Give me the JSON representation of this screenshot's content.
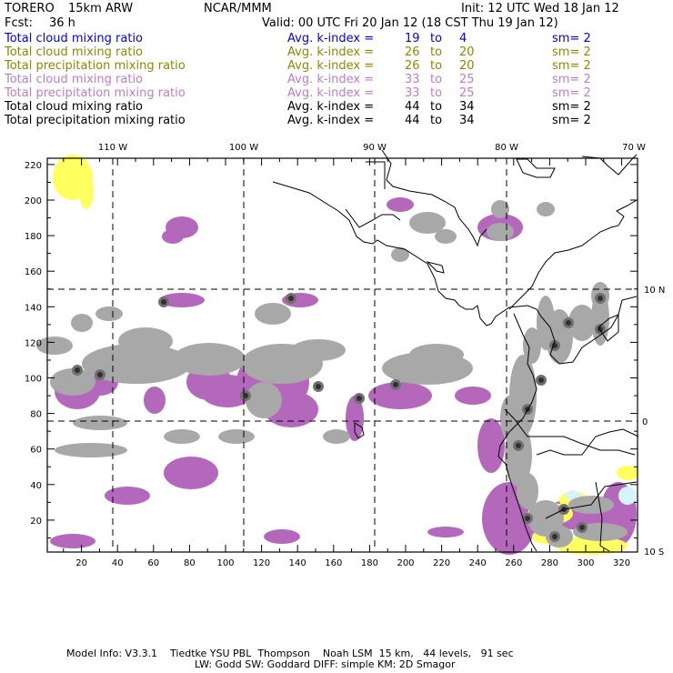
{
  "header": {
    "model": "TORERO",
    "resolution": "15km ARW",
    "org": "NCAR/MMM",
    "init": "Init: 12 UTC Wed 18 Jan 12",
    "fcst_label": "Fcst:",
    "fcst_value": "36 h",
    "valid": "Valid: 00 UTC Fri 20 Jan 12 (18 CST Thu 19 Jan 12)"
  },
  "legend": [
    {
      "field": "Total cloud mixing ratio",
      "avg": "Avg. k-index =",
      "from": "19",
      "to_word": "to",
      "to": "4",
      "sm": "sm= 2",
      "color": "#0000f0"
    },
    {
      "field": "Total cloud mixing ratio",
      "avg": "Avg. k-index =",
      "from": "26",
      "to_word": "to",
      "to": "20",
      "sm": "sm= 2",
      "color": "#8a8a00"
    },
    {
      "field": "Total precipitation mixing ratio",
      "avg": "Avg. k-index =",
      "from": "26",
      "to_word": "to",
      "to": "20",
      "sm": "sm= 2",
      "color": "#8a8a00"
    },
    {
      "field": "Total cloud mixing ratio",
      "avg": "Avg. k-index =",
      "from": "33",
      "to_word": "to",
      "to": "25",
      "sm": "sm= 2",
      "color": "#c07cc8"
    },
    {
      "field": "Total precipitation mixing ratio",
      "avg": "Avg. k-index =",
      "from": "33",
      "to_word": "to",
      "to": "25",
      "sm": "sm= 2",
      "color": "#c07cc8"
    },
    {
      "field": "Total cloud mixing ratio",
      "avg": "Avg. k-index =",
      "from": "44",
      "to_word": "to",
      "to": "34",
      "sm": "sm= 2",
      "color": "#000000"
    },
    {
      "field": "Total precipitation mixing ratio",
      "avg": "Avg. k-index =",
      "from": "44",
      "to_word": "to",
      "to": "34",
      "sm": "sm= 2",
      "color": "#000000"
    }
  ],
  "map": {
    "lon_labels": [
      "110 W",
      "100 W",
      "90 W",
      "80 W",
      "70 W"
    ],
    "lat_labels": [
      "10 N",
      "0",
      "10 S"
    ],
    "x_ticks": [
      "20",
      "40",
      "60",
      "80",
      "100",
      "120",
      "140",
      "160",
      "180",
      "200",
      "220",
      "240",
      "260",
      "280",
      "300",
      "320"
    ],
    "y_ticks": [
      "20",
      "40",
      "60",
      "80",
      "100",
      "120",
      "140",
      "160",
      "180",
      "200",
      "220"
    ],
    "colors": {
      "gray": "#a8a8a8",
      "purple": "#b468bc",
      "yellow": "#ffff60",
      "lightblue": "#d4f4ff"
    }
  },
  "footer": {
    "line1": "Model Info: V3.3.1    Tiedtke YSU PBL  Thompson    Noah LSM  15 km,   44 levels,   91 sec",
    "line2": "LW: Godd SW: Goddard DIFF: simple KM: 2D Smagor"
  }
}
